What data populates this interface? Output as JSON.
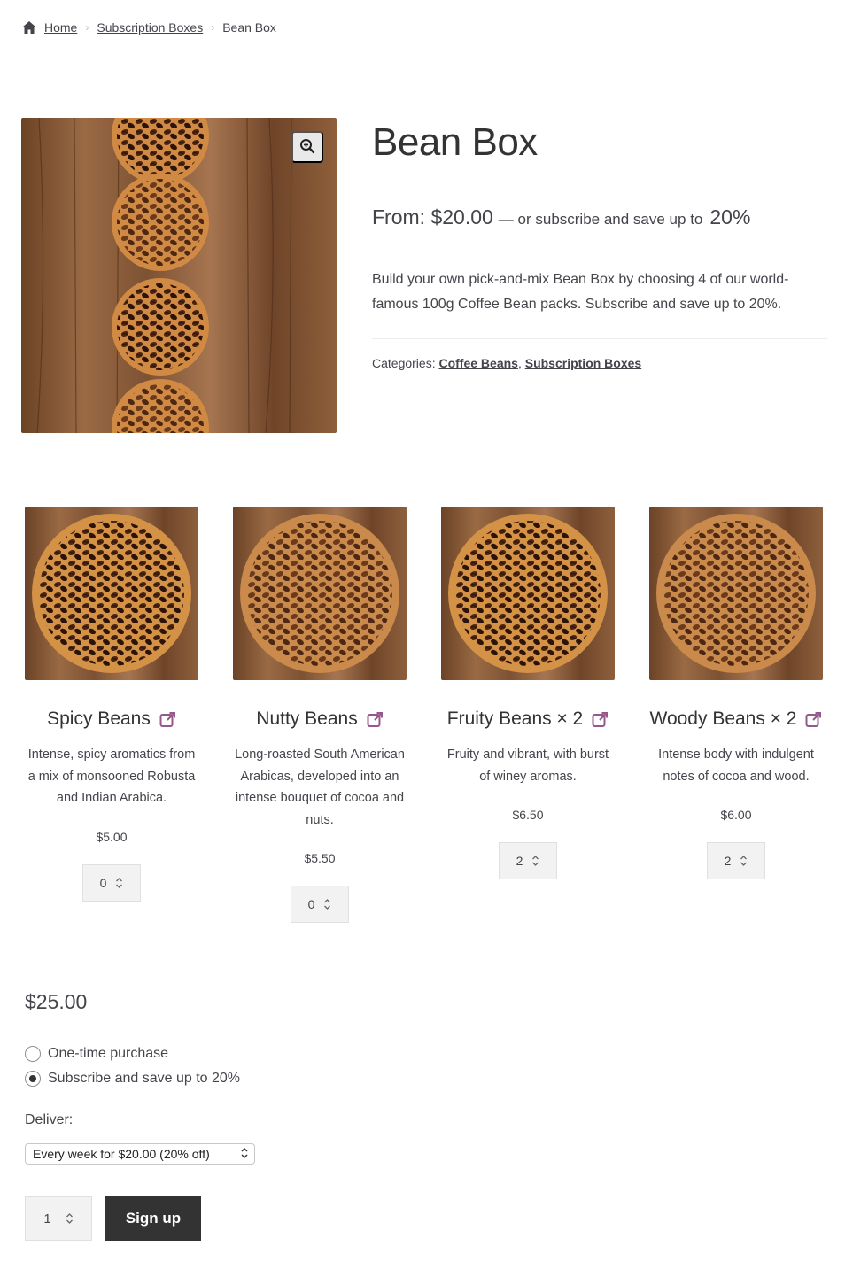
{
  "breadcrumb": {
    "icon": "home-icon",
    "home": "Home",
    "category": "Subscription Boxes",
    "current": "Bean Box"
  },
  "product": {
    "title": "Bean Box",
    "price_from": "From: $20.00",
    "price_rest": "— or subscribe and save up to",
    "price_pct": "20%",
    "description": "Build your own pick-and-mix Bean Box by choosing 4 of our world-famous 100g Coffee Bean packs. Subscribe and save up to 20%.",
    "categories_label": "Categories:",
    "categories": [
      "Coffee Beans",
      "Subscription Boxes"
    ],
    "zoom_icon": "zoom-in-icon"
  },
  "bundle_items": [
    {
      "name": "Spicy Beans",
      "desc": "Intense, spicy aromatics from a mix of monsooned Robusta and Indian Arabica.",
      "price": "$5.00",
      "qty": "0"
    },
    {
      "name": "Nutty Beans",
      "desc": "Long-roasted South American Arabicas, developed into an intense bouquet of cocoa and nuts.",
      "price": "$5.50",
      "qty": "0"
    },
    {
      "name": "Fruity Beans × 2",
      "desc": "Fruity and vibrant, with burst of winey aromas.",
      "price": "$6.50",
      "qty": "2"
    },
    {
      "name": "Woody Beans × 2",
      "desc": "Intense body with indulgent notes of cocoa and wood.",
      "price": "$6.00",
      "qty": "2"
    }
  ],
  "purchase": {
    "total": "$25.00",
    "option_one_time": "One-time purchase",
    "option_subscribe": "Subscribe and save up to 20%",
    "selected_option": "subscribe",
    "deliver_label": "Deliver:",
    "deliver_value": "Every week for $20.00 (20% off)",
    "quantity": "1",
    "button": "Sign up"
  },
  "colors": {
    "text": "#43454b",
    "heading": "#333333",
    "accent_link_icon": "#96588a",
    "button_bg": "#333333"
  }
}
